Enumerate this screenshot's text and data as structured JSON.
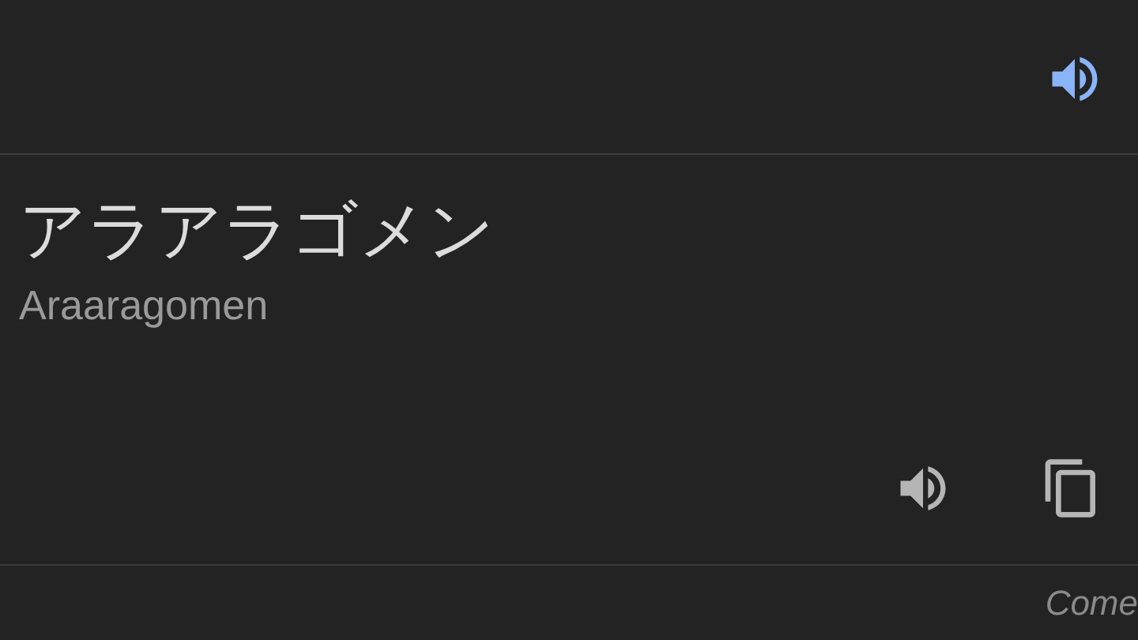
{
  "source_speaker": {
    "active": true
  },
  "translation": {
    "text": "アラアラゴメン",
    "romanization": "Araaragomen"
  },
  "footer": {
    "text": "Come"
  }
}
